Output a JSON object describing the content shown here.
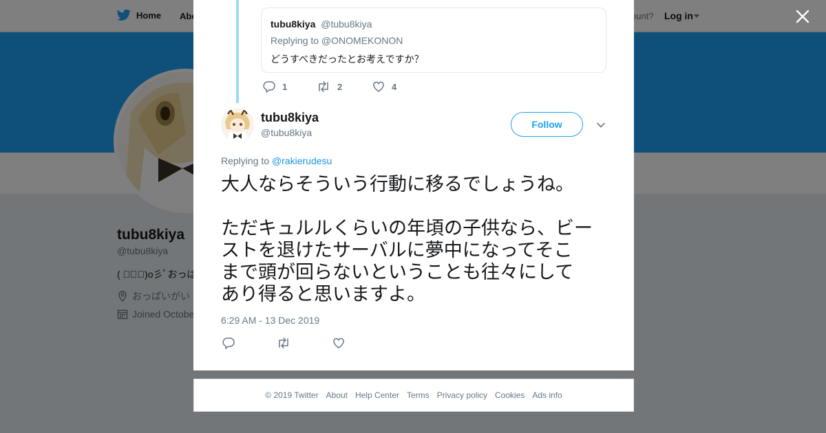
{
  "topbar": {
    "home_label": "Home",
    "about_label": "Abo",
    "account_text": "ccount?",
    "login_label": "Log in"
  },
  "profile": {
    "name": "tubu8kiya",
    "handle": "@tubu8kiya",
    "bio": "( ﾟ∀ﾟ)o彡ﾟおっぱ",
    "location": "おっぱいがい",
    "joined": "Joined Octobe"
  },
  "quoted_tweet": {
    "name": "tubu8kiya",
    "handle": "@tubu8kiya",
    "replying_to": "Replying to @ONOMEKONON",
    "text": "どうすべきだったとお考えですか？",
    "replies": "1",
    "retweets": "2",
    "likes": "4"
  },
  "tweet": {
    "name": "tubu8kiya",
    "handle": "@tubu8kiya",
    "follow_label": "Follow",
    "replying_prefix": "Replying to",
    "replying_user": "@rakierudesu",
    "line1": "大人ならそういう行動に移るでしょうね。",
    "line2": "ただキュルルくらいの年頃の子供なら、ビー",
    "line3": "ストを退けたサーバルに夢中になってそこ",
    "line4": "まで頭が回らないということも往々にして",
    "line5": "あり得ると思いますよ。",
    "timestamp": "6:29 AM - 13 Dec 2019"
  },
  "footer": {
    "copyright": "© 2019 Twitter",
    "about": "About",
    "help": "Help Center",
    "terms": "Terms",
    "privacy": "Privacy policy",
    "cookies": "Cookies",
    "ads": "Ads info"
  },
  "colors": {
    "twitter_blue": "#1da1f2",
    "link_blue": "#1b95e0",
    "thread_line": "#9fd7f9",
    "muted_text": "#657786"
  }
}
